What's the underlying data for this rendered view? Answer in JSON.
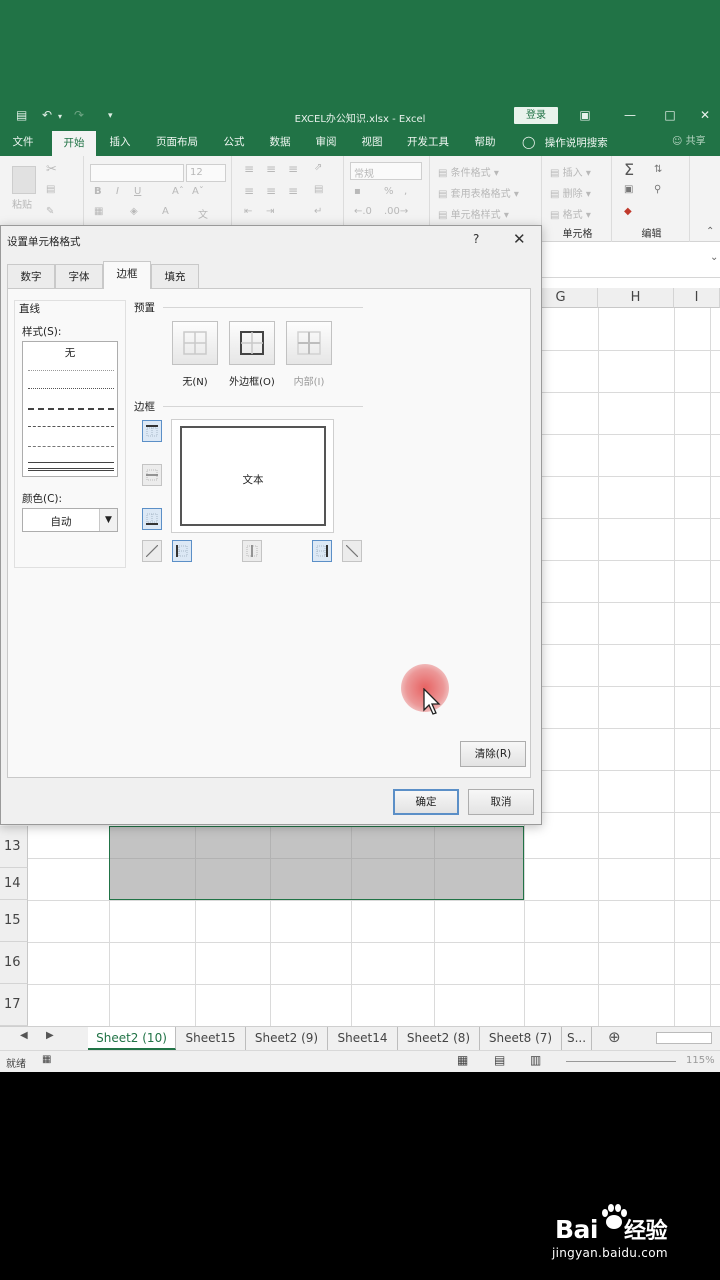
{
  "titlebar": {
    "filename": "EXCEL办公知识.xlsx",
    "separator": " - ",
    "app": "Excel",
    "login_label": "登录"
  },
  "ribbon_tabs": [
    {
      "label": "文件"
    },
    {
      "label": "开始"
    },
    {
      "label": "插入"
    },
    {
      "label": "页面布局"
    },
    {
      "label": "公式"
    },
    {
      "label": "数据"
    },
    {
      "label": "审阅"
    },
    {
      "label": "视图"
    },
    {
      "label": "开发工具"
    },
    {
      "label": "帮助"
    }
  ],
  "tell_me": "操作说明搜索",
  "share": "共享",
  "ribbon": {
    "paste_label": "粘贴",
    "font_size": "12",
    "number_format": "常规",
    "conditional_format": "条件格式",
    "table_format": "套用表格格式",
    "cell_styles": "单元格样式",
    "insert": "插入",
    "delete": "删除",
    "format": "格式",
    "cells_group": "单元格",
    "editing_group": "编辑"
  },
  "grid": {
    "columns": [
      "G",
      "H",
      "I"
    ],
    "rows": [
      "13",
      "14",
      "15",
      "16",
      "17"
    ]
  },
  "sheet_tabs": [
    {
      "label": "Sheet2 (10)",
      "active": true
    },
    {
      "label": "Sheet15"
    },
    {
      "label": "Sheet2 (9)"
    },
    {
      "label": "Sheet14"
    },
    {
      "label": "Sheet2 (8)"
    },
    {
      "label": "Sheet8 (7)"
    },
    {
      "label": "S..."
    }
  ],
  "statusbar": {
    "ready": "就绪",
    "zoom": "115%"
  },
  "dialog": {
    "title": "设置单元格格式",
    "help": "?",
    "close": "✕",
    "tabs": [
      {
        "label": "数字"
      },
      {
        "label": "字体"
      },
      {
        "label": "边框",
        "active": true
      },
      {
        "label": "填充"
      }
    ],
    "line_group": "直线",
    "style_label": "样式(S):",
    "style_none": "无",
    "color_label": "颜色(C):",
    "color_value": "自动",
    "preset_group": "预置",
    "presets": [
      {
        "label": "无(N)"
      },
      {
        "label": "外边框(O)"
      },
      {
        "label": "内部(I)",
        "disabled": true
      }
    ],
    "border_group": "边框",
    "preview_text": "文本",
    "clear_button": "清除(R)",
    "ok_button": "确定",
    "cancel_button": "取消"
  },
  "watermark": {
    "logo": "Bai",
    "logo_suffix": "经验",
    "url": "jingyan.baidu.com"
  },
  "colors": {
    "excel_green": "#217346",
    "selection_fill": "#c3c3c3",
    "dialog_bg": "#f0f0f0",
    "button_focus": "#5b8fc7",
    "cursor_glow": "#e65a5a"
  }
}
